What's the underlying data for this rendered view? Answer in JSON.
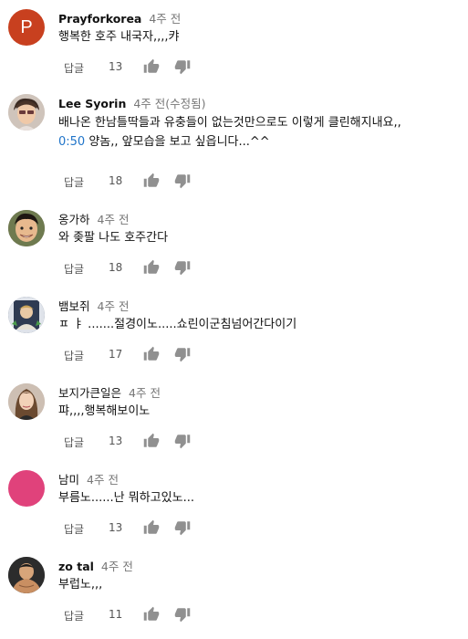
{
  "comments": [
    {
      "author": "Prayforkorea",
      "time": "4주 전",
      "text": "행복한 호주 내국자,,,,캬",
      "reply": "답글",
      "likes": "13",
      "avatar_letter": "P",
      "avatar_color": "#c8401f",
      "avatar_icon": "letter-avatar"
    },
    {
      "author": "Lee Syorin",
      "time": "4주 전(수정됨)",
      "text_line1": "배나온 한남틀딱들과 유충들이 없는것만으로도 이렇게 클린해지내요,,",
      "timestamp_link": "0:50",
      "text_line2": " 양놈,, 앞모습을 보고 싶읍니다...^^",
      "reply": "답글",
      "likes": "18",
      "avatar_icon": "photo-avatar"
    },
    {
      "author": "옹가하",
      "time": "4주 전",
      "text": "와 좆팔 나도 호주간다",
      "reply": "답글",
      "likes": "18",
      "avatar_icon": "photo-avatar"
    },
    {
      "author": "뱀보쥐",
      "time": "4주 전",
      "text": "ㅍ ㅑ .......절경이노.....쇼린이군침넘어간다이기",
      "reply": "답글",
      "likes": "17",
      "avatar_icon": "photo-avatar"
    },
    {
      "author": "보지가큰일은",
      "time": "4주 전",
      "text": "퍄,,,,행복해보이노",
      "reply": "답글",
      "likes": "13",
      "avatar_icon": "photo-avatar"
    },
    {
      "author": "남미",
      "time": "4주 전",
      "text": "부름노......난 뭐하고있노...",
      "reply": "답글",
      "likes": "13",
      "avatar_color": "#e0427b",
      "avatar_icon": "blank-avatar"
    },
    {
      "author": "zo tal",
      "time": "4주 전",
      "text": "부럽노,,,",
      "reply": "답글",
      "likes": "11",
      "avatar_icon": "photo-avatar"
    }
  ],
  "icons": {
    "like": "thumbs-up-icon",
    "dislike": "thumbs-down-icon"
  }
}
